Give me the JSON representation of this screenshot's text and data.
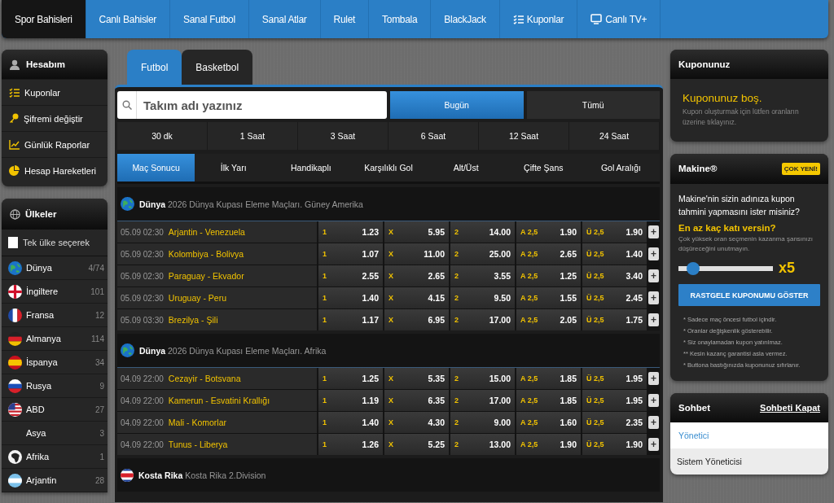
{
  "nav": [
    {
      "label": "Spor Bahisleri",
      "selected": true
    },
    {
      "label": "Canlı Bahisler",
      "selected": false
    },
    {
      "label": "Sanal Futbol",
      "selected": false
    },
    {
      "label": "Sanal Atlar",
      "selected": false
    },
    {
      "label": "Rulet",
      "selected": false
    },
    {
      "label": "Tombala",
      "selected": false
    },
    {
      "label": "BlackJack",
      "selected": false
    },
    {
      "label": "Kuponlar",
      "selected": false
    },
    {
      "label": "Canlı TV+",
      "selected": false
    }
  ],
  "account": {
    "title": "Hesabım",
    "items": [
      {
        "label": "Kuponlar"
      },
      {
        "label": "Şifremi değiştir"
      },
      {
        "label": "Günlük Raporlar"
      },
      {
        "label": "Hesap Hareketleri"
      }
    ]
  },
  "countries": {
    "title": "Ülkeler",
    "filter": {
      "label": "Tek ülke seçerek",
      "checked": false
    },
    "items": [
      {
        "name": "Dünya",
        "count": "4/74"
      },
      {
        "name": "İngiltere",
        "count": "101"
      },
      {
        "name": "Fransa",
        "count": "12"
      },
      {
        "name": "Almanya",
        "count": "114"
      },
      {
        "name": "İspanya",
        "count": "34"
      },
      {
        "name": "Rusya",
        "count": "9"
      },
      {
        "name": "ABD",
        "count": "27"
      },
      {
        "name": "Asya",
        "count": "3"
      },
      {
        "name": "Afrika",
        "count": "1"
      },
      {
        "name": "Arjantin",
        "count": "28"
      }
    ]
  },
  "sport_tabs": [
    {
      "label": "Futbol",
      "selected": true
    },
    {
      "label": "Basketbol",
      "selected": false
    }
  ],
  "search": {
    "placeholder": "Takım adı yazınız"
  },
  "day_filter": [
    {
      "label": "Bugün",
      "selected": true
    },
    {
      "label": "Tümü",
      "selected": false
    }
  ],
  "time_filter": [
    {
      "label": "30 dk"
    },
    {
      "label": "1 Saat"
    },
    {
      "label": "3 Saat"
    },
    {
      "label": "6 Saat"
    },
    {
      "label": "12 Saat"
    },
    {
      "label": "24 Saat"
    }
  ],
  "markets": [
    {
      "label": "Maç Sonucu",
      "selected": true
    },
    {
      "label": "İlk Yarı",
      "selected": false
    },
    {
      "label": "Handikaplı",
      "selected": false
    },
    {
      "label": "Karşılıklı Gol",
      "selected": false
    },
    {
      "label": "Alt/Üst",
      "selected": false
    },
    {
      "label": "Çifte Şans",
      "selected": false
    },
    {
      "label": "Gol Aralığı",
      "selected": false
    }
  ],
  "leagues": [
    {
      "country": "Dünya",
      "name": "2026 Dünya Kupası Eleme Maçları. Güney Amerika",
      "matches": [
        {
          "time": "05.09 02:30",
          "teams": "Arjantin - Venezuela",
          "odds": [
            {
              "label": "1",
              "value": "1.23"
            },
            {
              "label": "X",
              "value": "5.95"
            },
            {
              "label": "2",
              "value": "14.00"
            },
            {
              "label": "A 2,5",
              "value": "1.90"
            },
            {
              "label": "Ü 2,5",
              "value": "1.90"
            }
          ],
          "add": "+"
        },
        {
          "time": "05.09 02:30",
          "teams": "Kolombiya - Bolivya",
          "odds": [
            {
              "label": "1",
              "value": "1.07"
            },
            {
              "label": "X",
              "value": "11.00"
            },
            {
              "label": "2",
              "value": "25.00"
            },
            {
              "label": "A 2,5",
              "value": "2.65"
            },
            {
              "label": "Ü 2,5",
              "value": "1.40"
            }
          ],
          "add": "+"
        },
        {
          "time": "05.09 02:30",
          "teams": "Paraguay - Ekvador",
          "odds": [
            {
              "label": "1",
              "value": "2.55"
            },
            {
              "label": "X",
              "value": "2.65"
            },
            {
              "label": "2",
              "value": "3.55"
            },
            {
              "label": "A 2,5",
              "value": "1.25"
            },
            {
              "label": "Ü 2,5",
              "value": "3.40"
            }
          ],
          "add": "+"
        },
        {
          "time": "05.09 02:30",
          "teams": "Uruguay - Peru",
          "odds": [
            {
              "label": "1",
              "value": "1.40"
            },
            {
              "label": "X",
              "value": "4.15"
            },
            {
              "label": "2",
              "value": "9.50"
            },
            {
              "label": "A 2,5",
              "value": "1.55"
            },
            {
              "label": "Ü 2,5",
              "value": "2.45"
            }
          ],
          "add": "+"
        },
        {
          "time": "05.09 03:30",
          "teams": "Brezilya - Şili",
          "odds": [
            {
              "label": "1",
              "value": "1.17"
            },
            {
              "label": "X",
              "value": "6.95"
            },
            {
              "label": "2",
              "value": "17.00"
            },
            {
              "label": "A 2,5",
              "value": "2.05"
            },
            {
              "label": "Ü 2,5",
              "value": "1.75"
            }
          ],
          "add": "+"
        }
      ]
    },
    {
      "country": "Dünya",
      "name": "2026 Dünya Kupası Eleme Maçları. Afrika",
      "matches": [
        {
          "time": "04.09 22:00",
          "teams": "Cezayir - Botsvana",
          "odds": [
            {
              "label": "1",
              "value": "1.25"
            },
            {
              "label": "X",
              "value": "5.35"
            },
            {
              "label": "2",
              "value": "15.00"
            },
            {
              "label": "A 2,5",
              "value": "1.85"
            },
            {
              "label": "Ü 2,5",
              "value": "1.95"
            }
          ],
          "add": "+"
        },
        {
          "time": "04.09 22:00",
          "teams": "Kamerun - Esvatini Krallığı",
          "odds": [
            {
              "label": "1",
              "value": "1.19"
            },
            {
              "label": "X",
              "value": "6.35"
            },
            {
              "label": "2",
              "value": "17.00"
            },
            {
              "label": "A 2,5",
              "value": "1.85"
            },
            {
              "label": "Ü 2,5",
              "value": "1.95"
            }
          ],
          "add": "+"
        },
        {
          "time": "04.09 22:00",
          "teams": "Mali - Komorlar",
          "odds": [
            {
              "label": "1",
              "value": "1.40"
            },
            {
              "label": "X",
              "value": "4.30"
            },
            {
              "label": "2",
              "value": "9.00"
            },
            {
              "label": "A 2,5",
              "value": "1.60"
            },
            {
              "label": "Ü 2,5",
              "value": "2.35"
            }
          ],
          "add": "+"
        },
        {
          "time": "04.09 22:00",
          "teams": "Tunus - Liberya",
          "odds": [
            {
              "label": "1",
              "value": "1.26"
            },
            {
              "label": "X",
              "value": "5.25"
            },
            {
              "label": "2",
              "value": "13.00"
            },
            {
              "label": "A 2,5",
              "value": "1.90"
            },
            {
              "label": "Ü 2,5",
              "value": "1.90"
            }
          ],
          "add": "+"
        }
      ]
    },
    {
      "country": "Kosta Rika",
      "name": "Kosta Rika 2.Division"
    }
  ],
  "coupon": {
    "title": "Kuponunuz",
    "empty_title": "Kuponunuz boş.",
    "empty_text": "Kupon oluşturmak için lütfen oranların üzerine tıklayınız."
  },
  "machine": {
    "title": "Makine®",
    "badge": "ÇOK YENİ!",
    "question": "Makine'nin sizin adınıza kupon tahmini yapmasını ister misiniz?",
    "heading": "En az kaç katı versin?",
    "hint": "Çok yüksek oran seçmenin kazanma şansınızı düşüreceğini unutmayın.",
    "slider": {
      "level": 0.1
    },
    "multiplier": "x5",
    "button": "RASTGELE KUPONUMU GÖSTER",
    "notes": [
      "* Sadece maç öncesi futbol içindir.",
      "* Oranlar değişkenlik gösterebilir.",
      "* Siz onaylamadan kupon yatırılmaz.",
      "** Kesin kazanç garantisi asla vermez.",
      "* Buttona bastığınızda kuponunuz sıfırlanır."
    ]
  },
  "chat": {
    "title": "Sohbet",
    "close_link": "Sohbeti Kapat",
    "items": [
      {
        "label": "Yönetici",
        "kind": "group"
      },
      {
        "label": "Sistem Yöneticisi",
        "kind": "user"
      }
    ]
  }
}
